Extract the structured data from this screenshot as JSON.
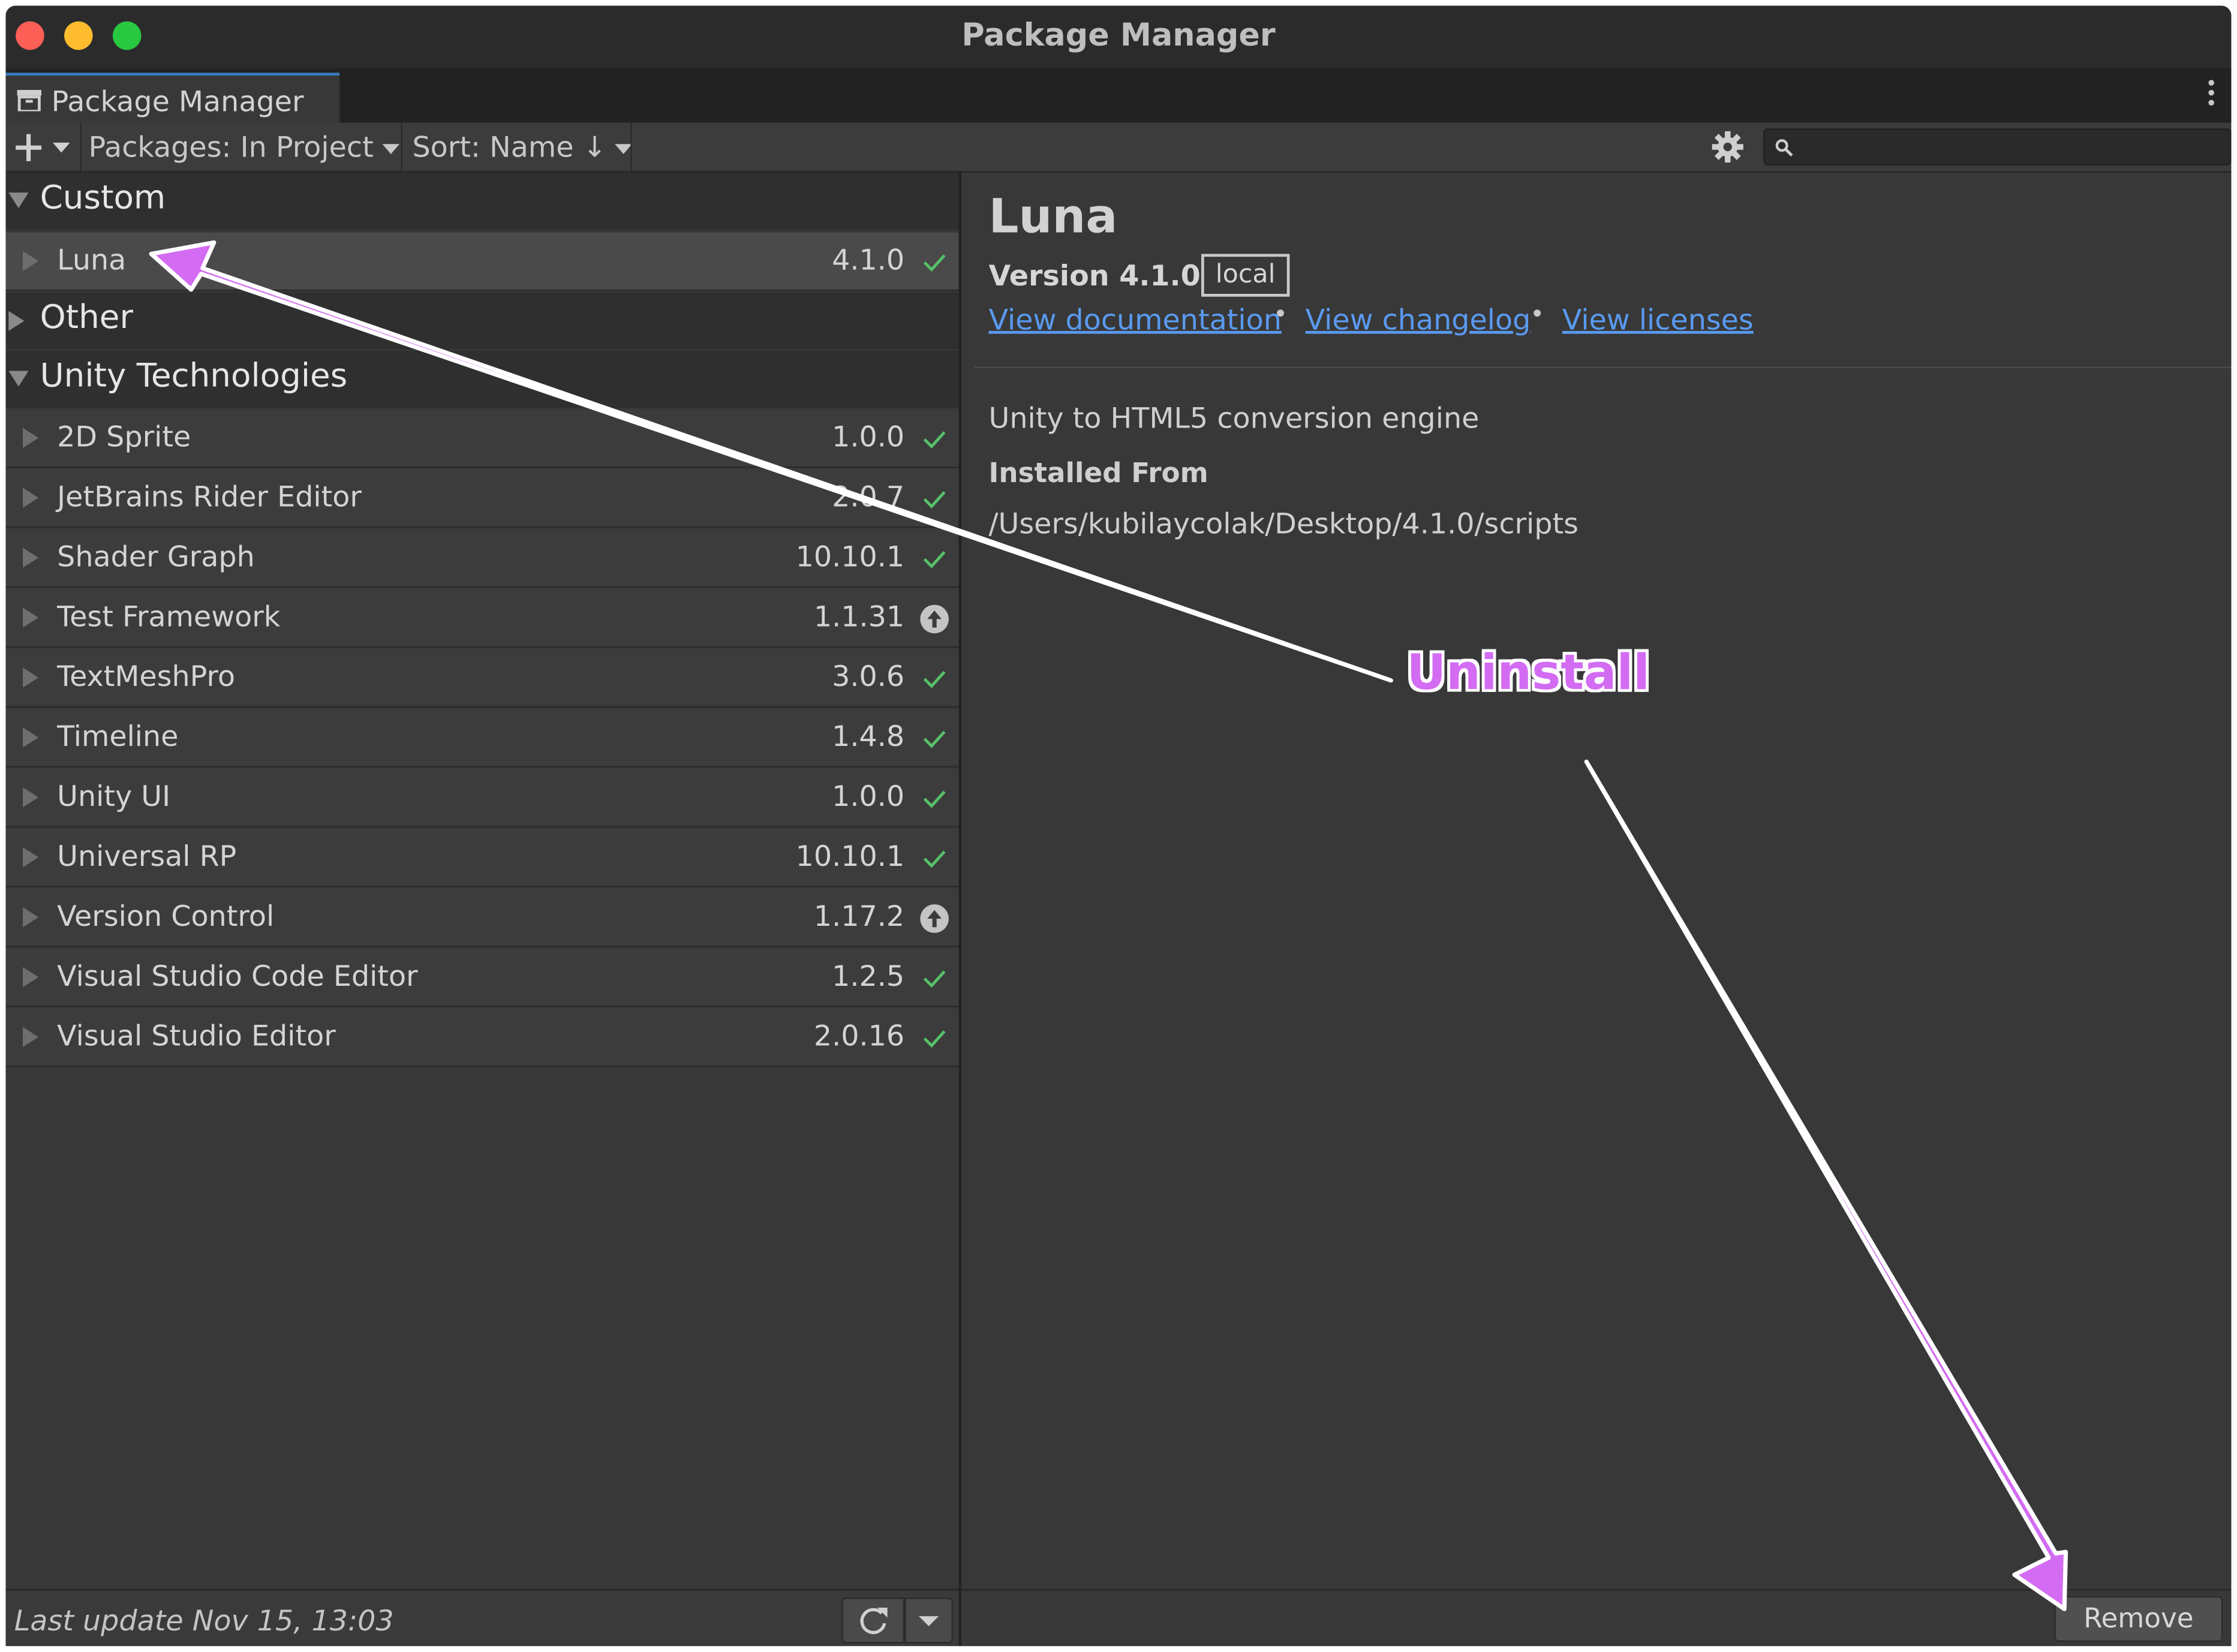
{
  "window": {
    "title": "Package Manager"
  },
  "tab": {
    "label": "Package Manager"
  },
  "toolbar": {
    "packages_filter": "Packages: In Project",
    "sort": "Sort: Name ↓",
    "search_placeholder": ""
  },
  "groups": {
    "custom": "Custom",
    "other": "Other",
    "unity": "Unity Technologies"
  },
  "packages": [
    {
      "name": "Luna",
      "version": "4.1.0",
      "status": "installed"
    },
    {
      "name": "2D Sprite",
      "version": "1.0.0",
      "status": "installed"
    },
    {
      "name": "JetBrains Rider Editor",
      "version": "2.0.7",
      "status": "installed"
    },
    {
      "name": "Shader Graph",
      "version": "10.10.1",
      "status": "installed"
    },
    {
      "name": "Test Framework",
      "version": "1.1.31",
      "status": "update-available"
    },
    {
      "name": "TextMeshPro",
      "version": "3.0.6",
      "status": "installed"
    },
    {
      "name": "Timeline",
      "version": "1.4.8",
      "status": "installed"
    },
    {
      "name": "Unity UI",
      "version": "1.0.0",
      "status": "installed"
    },
    {
      "name": "Universal RP",
      "version": "10.10.1",
      "status": "installed"
    },
    {
      "name": "Version Control",
      "version": "1.17.2",
      "status": "update-available"
    },
    {
      "name": "Visual Studio Code Editor",
      "version": "1.2.5",
      "status": "installed"
    },
    {
      "name": "Visual Studio Editor",
      "version": "2.0.16",
      "status": "installed"
    }
  ],
  "status_bar": {
    "last_update": "Last update Nov 15, 13:03"
  },
  "details": {
    "title": "Luna",
    "version": "Version 4.1.0",
    "source_tag": "local",
    "links": {
      "documentation": "View documentation",
      "changelog": "View changelog",
      "licenses": "View licenses"
    },
    "description": "Unity to HTML5 conversion engine",
    "installed_from_label": "Installed From",
    "installed_from_path": "/Users/kubilaycolak/Desktop/4.1.0/scripts",
    "remove_label": "Remove"
  },
  "annotation": {
    "label": "Uninstall",
    "color": "#d36cf2"
  },
  "colors": {
    "installed_check": "#56c26a",
    "link": "#5a9af0",
    "tab_accent": "#3a79bb"
  },
  "icons": {
    "installed": "checkmark-icon",
    "update": "update-arrow-icon",
    "settings": "gear-icon",
    "search": "search-icon",
    "refresh": "refresh-icon",
    "add": "plus-icon",
    "menu": "kebab-menu-icon"
  }
}
